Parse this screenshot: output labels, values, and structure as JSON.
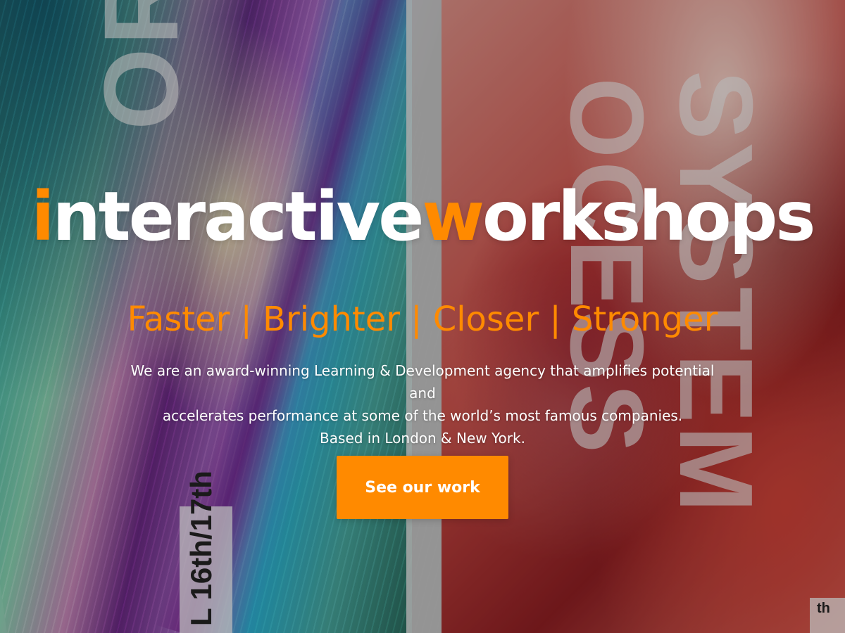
{
  "colors": {
    "accent": "#ff8a00",
    "text": "#ffffff"
  },
  "hero": {
    "background_text": {
      "left_word": "ORATION",
      "right_word_1": "OCESS",
      "right_word_2": "SYSTEM",
      "left_tag": "L 16th/17th",
      "right_tag": "th"
    },
    "logo": {
      "part_1": "i",
      "part_2": "nteractive",
      "part_3": "w",
      "part_4": "orkshops"
    },
    "tagline": "Faster | Brighter | Closer | Stronger",
    "description": {
      "line_1": "We are an award-winning Learning & Development agency that amplifies potential and",
      "line_2": "accelerates performance at some of the world’s most famous companies.",
      "line_3": "Based in London & New York."
    },
    "cta_label": "See our work"
  }
}
